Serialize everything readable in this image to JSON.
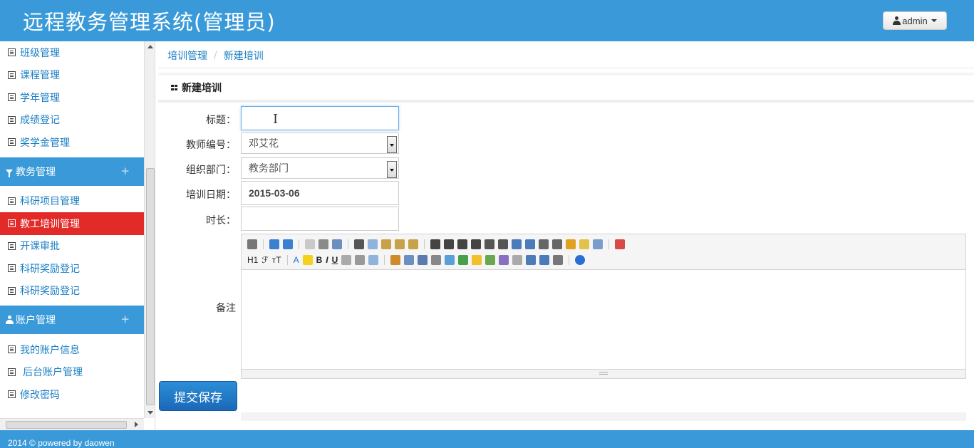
{
  "header": {
    "title": "远程教务管理系统(管理员)",
    "user_label": "admin",
    "user_icon": "user-icon"
  },
  "sidebar": {
    "group1_items": [
      {
        "label": "班级管理"
      },
      {
        "label": "课程管理"
      },
      {
        "label": "学年管理"
      },
      {
        "label": "成绩登记"
      },
      {
        "label": "奖学金管理"
      }
    ],
    "group2": {
      "label": "教务管理",
      "icon": "filter-icon",
      "toggle": "+"
    },
    "group2_items": [
      {
        "label": "科研项目管理"
      },
      {
        "label": "教工培训管理",
        "active": true
      },
      {
        "label": "开课审批"
      },
      {
        "label": "科研奖励登记"
      },
      {
        "label": "科研奖励登记"
      }
    ],
    "group3": {
      "label": "账户管理",
      "icon": "user-icon",
      "toggle": "+"
    },
    "group3_items": [
      {
        "label": "我的账户信息"
      },
      {
        "label": "后台账户管理"
      },
      {
        "label": "修改密码"
      }
    ],
    "active_color": "#e22a28"
  },
  "breadcrumb": {
    "parent": "培训管理",
    "current": "新建培训"
  },
  "panel": {
    "title": "新建培训"
  },
  "form": {
    "title_label": "标题：",
    "title_value": "",
    "teacher_label": "教师编号：",
    "teacher_value": "邓艾花",
    "dept_label": "组织部门：",
    "dept_value": "教务部门",
    "date_label": "培训日期：",
    "date_value": "2015-03-06",
    "duration_label": "时长：",
    "duration_value": "",
    "note_label": "备注",
    "submit_label": "提交保存"
  },
  "editor": {
    "heading_btn": "H1",
    "font_btn": "ℱ",
    "size_btn": "тT",
    "color_btn": "A",
    "bold_btn": "B",
    "italic_btn": "I",
    "underline_btn": "U"
  },
  "footer": {
    "text": "2014 © powered by daowen"
  },
  "colors": {
    "primary": "#3a9ad9",
    "link": "#1a7ec4",
    "submit": "#1b68b8"
  }
}
